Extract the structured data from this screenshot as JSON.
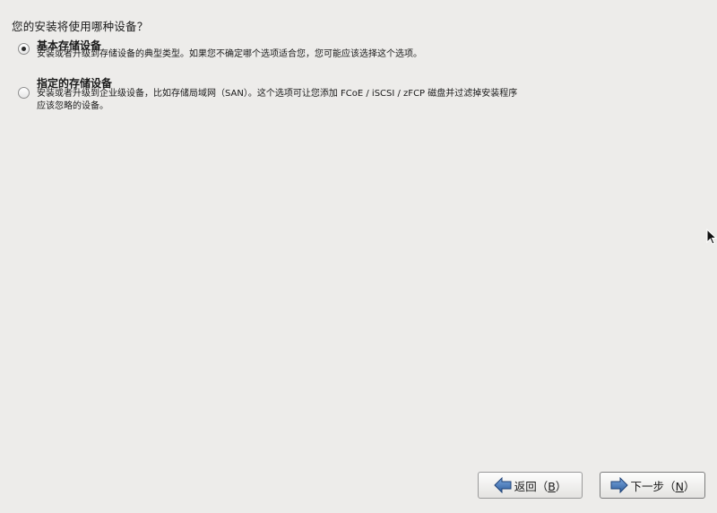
{
  "question": "您的安装将使用哪种设备？",
  "options": [
    {
      "title": "基本存储设备",
      "description": "安装或者升级到存储设备的典型类型。如果您不确定哪个选项适合您，您可能应该选择这个选项。",
      "selected": true
    },
    {
      "title": "指定的存储设备",
      "description_line1": "安装或者升级到企业级设备，比如存储局域网（SAN）。这个选项可让您添加 FCoE / iSCSI / zFCP 磁盘并过滤掉安装程序",
      "description_line2": "应该忽略的设备。",
      "selected": false
    }
  ],
  "buttons": {
    "back": {
      "label_prefix": "返回（",
      "mnemonic": "B",
      "label_suffix": "）",
      "icon": "arrow-left-icon"
    },
    "next": {
      "label_prefix": "下一步（",
      "mnemonic": "N",
      "label_suffix": "）",
      "icon": "arrow-right-icon"
    }
  },
  "colors": {
    "background": "#edecea",
    "arrow_blue": "#3a6fb5"
  }
}
